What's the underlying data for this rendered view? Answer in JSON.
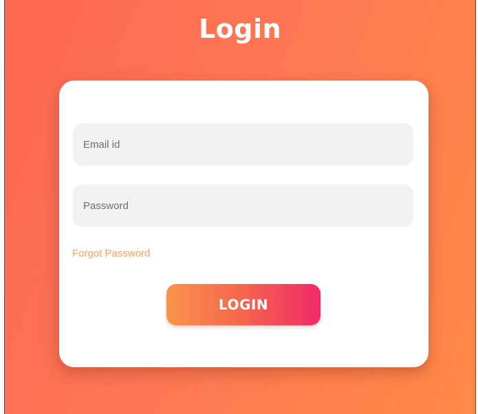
{
  "page": {
    "title": "Login"
  },
  "form": {
    "email": {
      "placeholder": "Email id",
      "value": ""
    },
    "password": {
      "placeholder": "Password",
      "value": ""
    },
    "forgot_password_label": "Forgot Password",
    "submit_label": "LOGIN"
  },
  "colors": {
    "background_start": "#fd6852",
    "background_end": "#ff8a48",
    "card": "#ffffff",
    "field_background": "#f1f1f1",
    "link": "#f4a35e",
    "button_gradient_start": "#f8944a",
    "button_gradient_end": "#f2296a"
  }
}
